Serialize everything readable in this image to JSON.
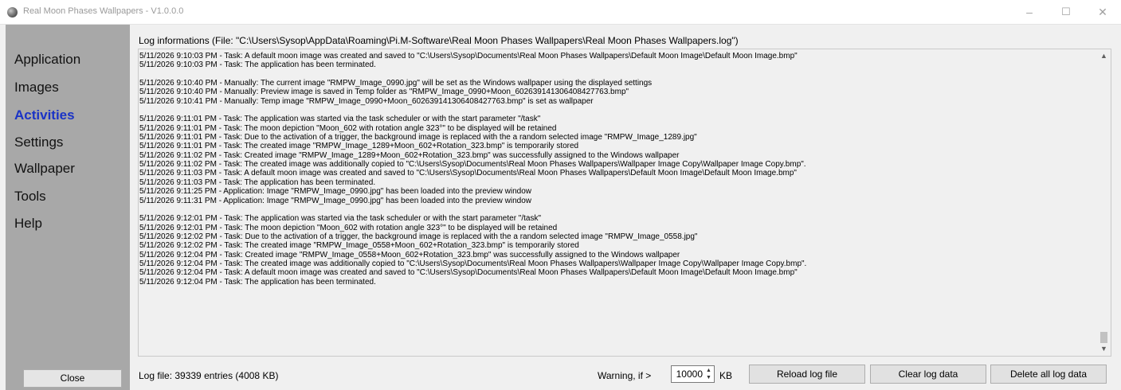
{
  "window": {
    "title": "Real Moon Phases Wallpapers - V1.0.0.0",
    "icon": "moon-icon",
    "controls": {
      "minimize": "–",
      "maximize": "☐",
      "close": "✕"
    }
  },
  "sidebar": {
    "items": [
      {
        "label": "Application",
        "active": false
      },
      {
        "label": "Images",
        "active": false
      },
      {
        "label": "Activities",
        "active": true
      },
      {
        "label": "Settings",
        "active": false
      },
      {
        "label": "Wallpaper",
        "active": false
      },
      {
        "label": "Tools",
        "active": false
      },
      {
        "label": "Help",
        "active": false
      }
    ],
    "close_label": "Close",
    "active_color": "#1a33c6",
    "background_color": "#a8a8a8"
  },
  "log": {
    "header": "Log informations (File: \"C:\\Users\\Sysop\\AppData\\Roaming\\Pi.M-Software\\Real Moon Phases Wallpapers\\Real Moon Phases Wallpapers.log\")",
    "lines": [
      "5/11/2026 9:10:03 PM - Task: A default moon image was created and saved to \"C:\\Users\\Sysop\\Documents\\Real Moon Phases Wallpapers\\Default Moon Image\\Default Moon Image.bmp\"",
      "5/11/2026 9:10:03 PM - Task: The application has been terminated.",
      "",
      "5/11/2026 9:10:40 PM - Manually: The current image \"RMPW_Image_0990.jpg\" will be set as the Windows wallpaper using the displayed settings",
      "5/11/2026 9:10:40 PM - Manually: Preview image is saved in Temp folder as \"RMPW_Image_0990+Moon_602639141306408427763.bmp\"",
      "5/11/2026 9:10:41 PM - Manually: Temp image \"RMPW_Image_0990+Moon_602639141306408427763.bmp\" is set as wallpaper",
      "",
      "5/11/2026 9:11:01 PM - Task: The application was started via the task scheduler or with the start parameter \"/task\"",
      "5/11/2026 9:11:01 PM - Task: The moon depiction \"Moon_602 with rotation angle 323°\" to be displayed will be retained",
      "5/11/2026 9:11:01 PM - Task: Due to the activation of a trigger, the background image is replaced with the a random selected image \"RMPW_Image_1289.jpg\"",
      "5/11/2026 9:11:01 PM - Task: The created image \"RMPW_Image_1289+Moon_602+Rotation_323.bmp\" is temporarily stored",
      "5/11/2026 9:11:02 PM - Task: Created image \"RMPW_Image_1289+Moon_602+Rotation_323.bmp\" was successfully assigned to the Windows wallpaper",
      "5/11/2026 9:11:02 PM - Task: The created image was additionally copied to \"C:\\Users\\Sysop\\Documents\\Real Moon Phases Wallpapers\\Wallpaper Image Copy\\Wallpaper Image Copy.bmp\".",
      "5/11/2026 9:11:03 PM - Task: A default moon image was created and saved to \"C:\\Users\\Sysop\\Documents\\Real Moon Phases Wallpapers\\Default Moon Image\\Default Moon Image.bmp\"",
      "5/11/2026 9:11:03 PM - Task: The application has been terminated.",
      "5/11/2026 9:11:25 PM - Application: Image \"RMPW_Image_0990.jpg\" has been loaded into the preview window",
      "5/11/2026 9:11:31 PM - Application: Image \"RMPW_Image_0990.jpg\" has been loaded into the preview window",
      "",
      "5/11/2026 9:12:01 PM - Task: The application was started via the task scheduler or with the start parameter \"/task\"",
      "5/11/2026 9:12:01 PM - Task: The moon depiction \"Moon_602 with rotation angle 323°\" to be displayed will be retained",
      "5/11/2026 9:12:02 PM - Task: Due to the activation of a trigger, the background image is replaced with the a random selected image \"RMPW_Image_0558.jpg\"",
      "5/11/2026 9:12:02 PM - Task: The created image \"RMPW_Image_0558+Moon_602+Rotation_323.bmp\" is temporarily stored",
      "5/11/2026 9:12:04 PM - Task: Created image \"RMPW_Image_0558+Moon_602+Rotation_323.bmp\" was successfully assigned to the Windows wallpaper",
      "5/11/2026 9:12:04 PM - Task: The created image was additionally copied to \"C:\\Users\\Sysop\\Documents\\Real Moon Phases Wallpapers\\Wallpaper Image Copy\\Wallpaper Image Copy.bmp\".",
      "5/11/2026 9:12:04 PM - Task: A default moon image was created and saved to \"C:\\Users\\Sysop\\Documents\\Real Moon Phases Wallpapers\\Default Moon Image\\Default Moon Image.bmp\"",
      "5/11/2026 9:12:04 PM - Task: The application has been terminated."
    ],
    "scroll_position": 0.95
  },
  "footer": {
    "status": "Log file: 39339 entries (4008 KB)",
    "warning_label": "Warning, if >",
    "warning_value": "10000",
    "unit": "KB",
    "buttons": {
      "reload": "Reload log file",
      "clear": "Clear log data",
      "delete_all": "Delete all log data"
    }
  }
}
